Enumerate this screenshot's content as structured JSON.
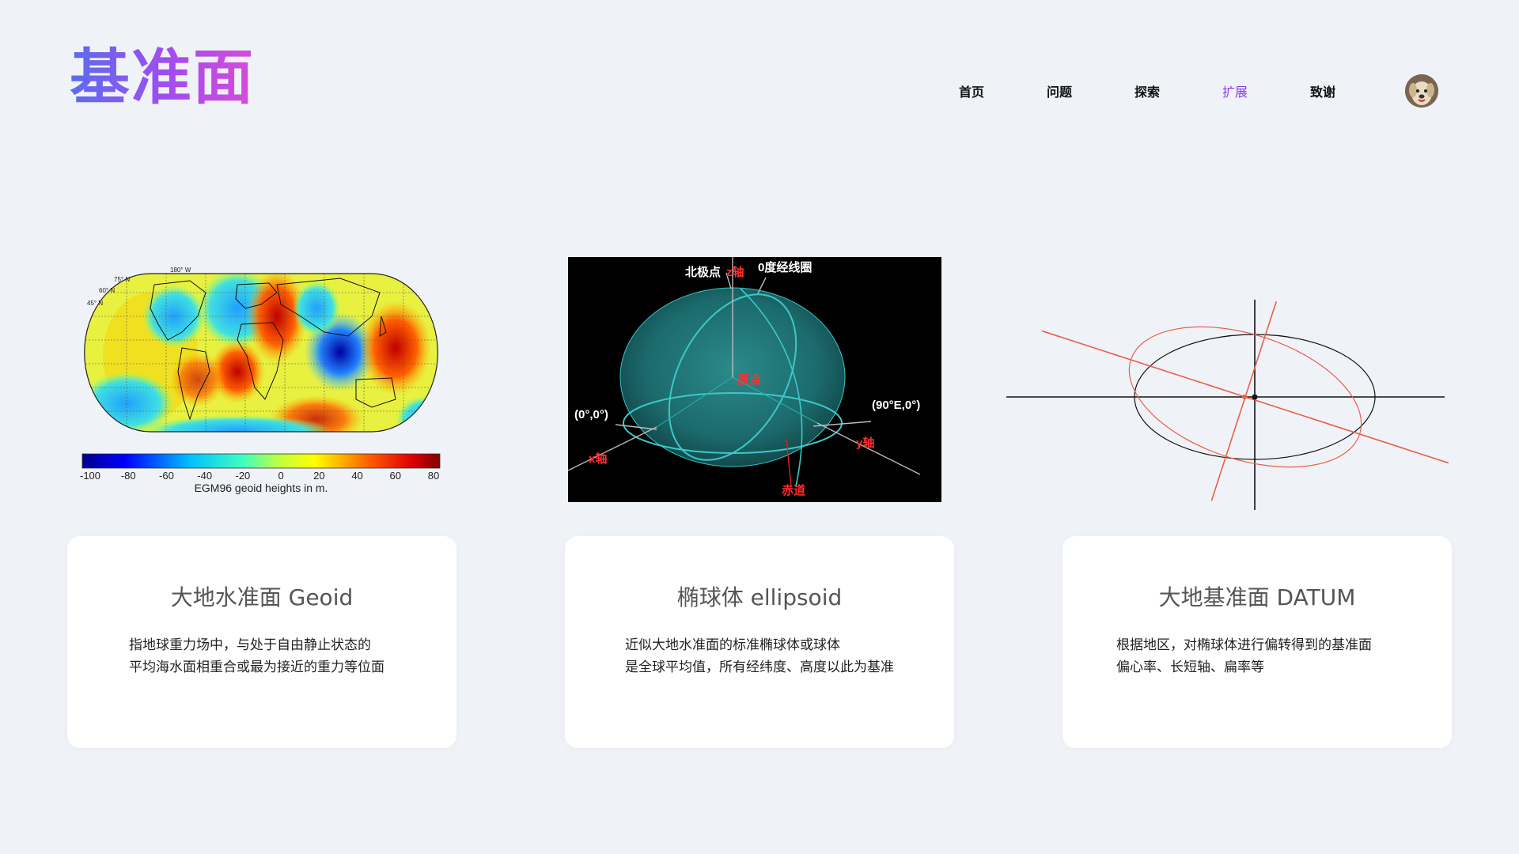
{
  "header": {
    "logo_text": "基准面",
    "nav": [
      "首页",
      "问题",
      "探索",
      "扩展",
      "致谢"
    ],
    "active_index": 3
  },
  "figures": {
    "geoid": {
      "lat_labels": [
        "45° N",
        "60° N",
        "75° N"
      ],
      "lon_label": "180° W",
      "colorbar_ticks": [
        "-100",
        "-80",
        "-60",
        "-40",
        "-20",
        "0",
        "20",
        "40",
        "60",
        "80"
      ],
      "caption": "EGM96 geoid heights in m."
    },
    "ellipsoid": {
      "north_pole": "北极点",
      "z_axis": "z轴",
      "meridian": "0度经线圈",
      "origin": "原点",
      "point_00": "(0°,0°)",
      "point_90": "(90°E,0°)",
      "x_axis": "x轴",
      "y_axis": "y轴",
      "equator": "赤道"
    }
  },
  "cards": [
    {
      "title": "大地水准面 Geoid",
      "lines": [
        "指地球重力场中，与处于自由静止状态的",
        "平均海水面相重合或最为接近的重力等位面"
      ]
    },
    {
      "title": "椭球体 ellipsoid",
      "lines": [
        "近似大地水准面的标准椭球体或球体",
        "是全球平均值，所有经纬度、高度以此为基准"
      ]
    },
    {
      "title": "大地基准面 DATUM",
      "lines": [
        "根据地区，对椭球体进行偏转得到的基准面",
        "偏心率、长短轴、扁率等"
      ]
    }
  ],
  "colors": {
    "accent": "#8a3cf0",
    "background": "#eff2f7",
    "datum_red": "#e8604c"
  }
}
